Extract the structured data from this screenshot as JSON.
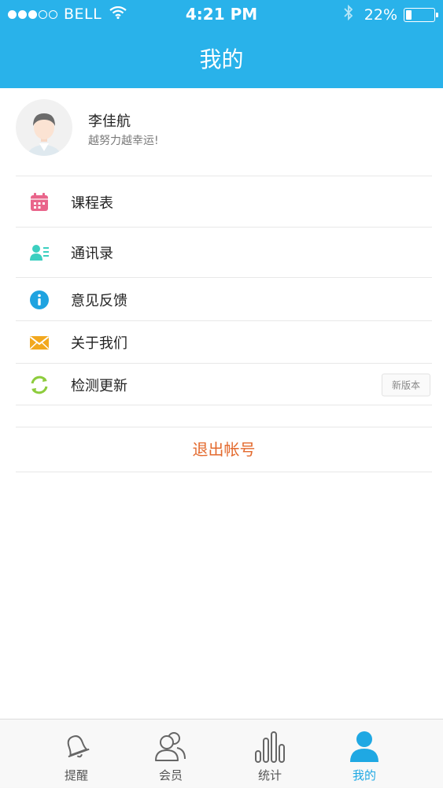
{
  "status_bar": {
    "signal_dots_filled": 3,
    "signal_dots_total": 5,
    "carrier": "BELL",
    "time": "4:21 PM",
    "battery_percent": "22%",
    "battery_level": 0.22
  },
  "nav": {
    "title": "我的"
  },
  "profile": {
    "name": "李佳航",
    "motto": "越努力越幸运!"
  },
  "menu": [
    {
      "label": "课程表",
      "icon": "calendar-icon",
      "color": "#e9658b"
    },
    {
      "label": "通讯录",
      "icon": "contacts-icon",
      "color": "#3ccfc0"
    },
    {
      "label": "意见反馈",
      "icon": "info-icon",
      "color": "#1fa3e0"
    },
    {
      "label": "关于我们",
      "icon": "mail-icon",
      "color": "#f2a81e"
    },
    {
      "label": "检测更新",
      "icon": "refresh-icon",
      "color": "#8dcc3c",
      "badge": "新版本"
    }
  ],
  "logout": {
    "label": "退出帐号",
    "color": "#e36a2e"
  },
  "tabs": [
    {
      "label": "提醒",
      "icon": "bell-icon",
      "active": false
    },
    {
      "label": "会员",
      "icon": "members-icon",
      "active": false
    },
    {
      "label": "统计",
      "icon": "bar-chart-icon",
      "active": false
    },
    {
      "label": "我的",
      "icon": "person-icon",
      "active": true
    }
  ],
  "colors": {
    "primary": "#29b2ea",
    "active_tab": "#1fa8e3"
  }
}
